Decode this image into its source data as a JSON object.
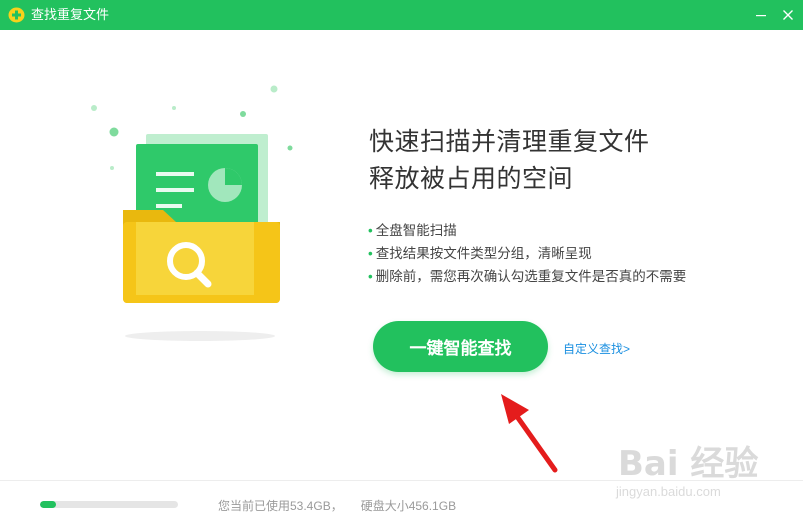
{
  "window": {
    "title": "查找重复文件",
    "icons": [
      "app-logo-icon",
      "minimize-icon",
      "close-icon"
    ]
  },
  "main": {
    "headline_line1": "快速扫描并清理重复文件",
    "headline_line2": "释放被占用的空间",
    "features": [
      "全盘智能扫描",
      "查找结果按文件类型分组，清晰呈现",
      "删除前，需您再次确认勾选重复文件是否真的不需要"
    ],
    "primary_button": "一键智能查找",
    "custom_link": "自定义查找>"
  },
  "footer": {
    "used_text": "您当前已使用53.4GB，",
    "disk_text": "硬盘大小456.1GB",
    "usage_fraction": 0.117
  },
  "watermark": {
    "brand": "Bai 经验",
    "url": "jingyan.baidu.com"
  },
  "colors": {
    "accent": "#22c15e",
    "link": "#1a8fe0",
    "annotation_arrow": "#e41c1c",
    "folder": "#f5c518"
  }
}
